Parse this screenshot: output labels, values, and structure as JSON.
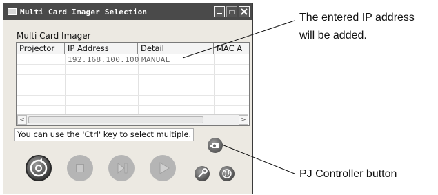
{
  "window": {
    "title": "Multi Card Imager Selection",
    "group_label": "Multi Card Imager",
    "columns": [
      "Projector",
      "IP Address",
      "Detail",
      "MAC A"
    ],
    "rows": [
      {
        "projector": "",
        "ip": "192.168.100.100",
        "detail": "MANUAL"
      }
    ],
    "scroll_left": "<",
    "scroll_right": ">",
    "hint_text": "You can use the 'Ctrl' key to select multiple."
  },
  "annotations": {
    "ip_added_line1": "The entered IP address",
    "ip_added_line2": "will be added.",
    "pj_controller": "PJ Controller button"
  },
  "icons": [
    "app-icon",
    "minimize-icon",
    "maximize-icon",
    "close-icon",
    "refresh-icon",
    "stop-icon",
    "skip-icon",
    "play-icon",
    "pj-controller-icon",
    "settings-icon",
    "globe-icon"
  ]
}
